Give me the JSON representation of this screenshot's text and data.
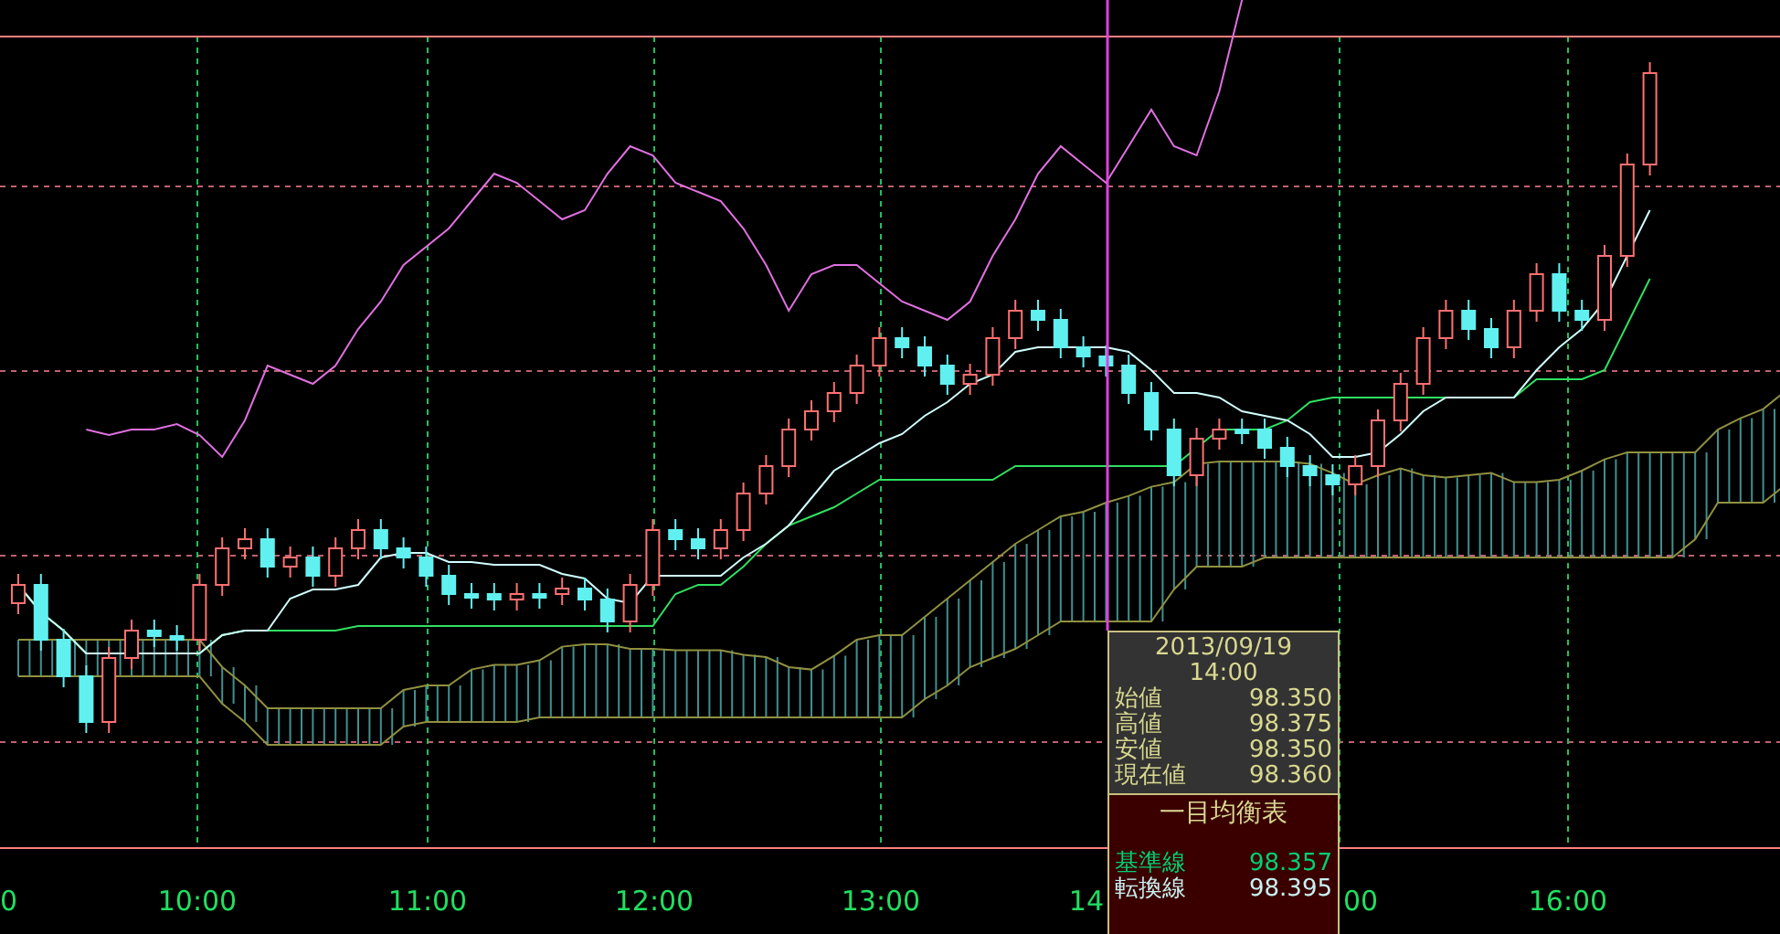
{
  "chart": {
    "x_labels": [
      "0",
      "10:00",
      "11:00",
      "12:00",
      "13:00",
      "14",
      "00",
      "16:00"
    ]
  },
  "tooltip": {
    "date": "2013/09/19",
    "time": "14:00",
    "rows": [
      {
        "label": "始値",
        "value": "98.350"
      },
      {
        "label": "高値",
        "value": "98.375"
      },
      {
        "label": "安値",
        "value": "98.350"
      },
      {
        "label": "現在値",
        "value": "98.360"
      }
    ],
    "section_title": "一目均衡表",
    "indicators": [
      {
        "label": "基準線",
        "value": "98.357",
        "color": "#00d070"
      },
      {
        "label": "転換線",
        "value": "98.395",
        "color": "#c8f0f0"
      }
    ]
  }
}
